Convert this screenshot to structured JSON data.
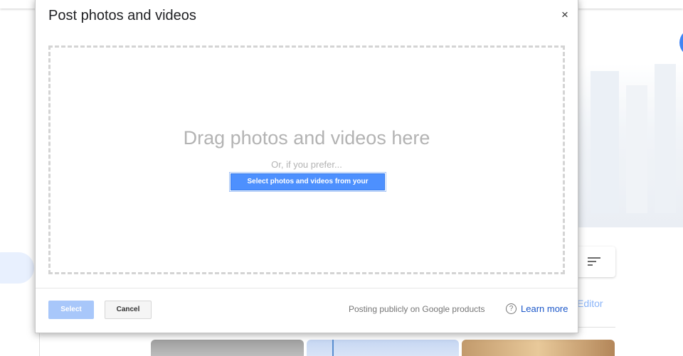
{
  "dialog": {
    "title": "Post photos and videos",
    "close_glyph": "×",
    "dropzone": {
      "heading": "Drag photos and videos here",
      "subtext": "Or, if you prefer...",
      "select_computer_label": "Select photos and videos from your computer"
    },
    "footer": {
      "select_label": "Select",
      "cancel_label": "Cancel",
      "posting_text": "Posting publicly on Google products",
      "help_glyph": "?",
      "learn_more_label": "Learn more"
    }
  },
  "background": {
    "editor_text": "Editor"
  },
  "colors": {
    "primary_button": "#4d90fe",
    "disabled_button": "#a8c7fa",
    "link": "#1a56c9"
  }
}
